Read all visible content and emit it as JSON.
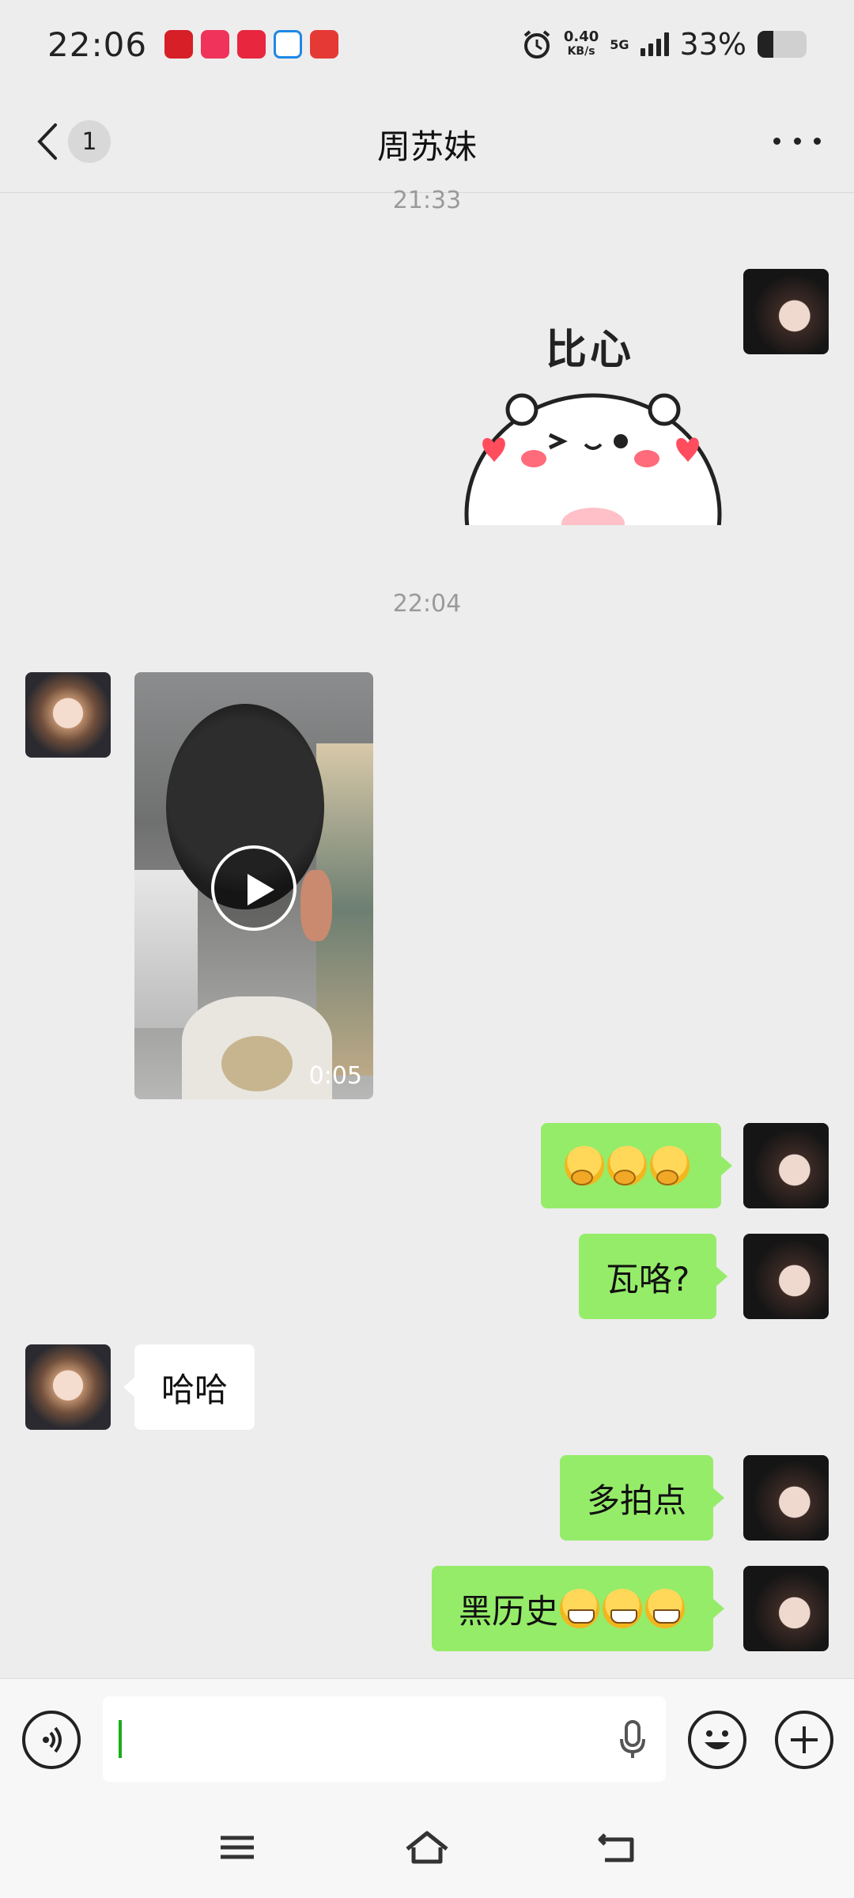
{
  "status_bar": {
    "time": "22:06",
    "speed_value": "0.40",
    "speed_unit": "KB/s",
    "network": "5G",
    "battery_percent": "33%",
    "battery_level": 0.33
  },
  "header": {
    "unread_count": "1",
    "title": "周苏妹"
  },
  "messages": {
    "timestamp_1": "21:33",
    "sticker_text": "比心",
    "timestamp_2": "22:04",
    "video_duration": "0:05",
    "msg_wa_ge": "瓦咯?",
    "msg_haha": "哈哈",
    "msg_duo_pai_dian": "多拍点",
    "msg_hei_li_shi": "黑历史"
  },
  "colors": {
    "my_bubble": "#95ec69",
    "other_bubble": "#ffffff",
    "background": "#ededed"
  },
  "icons": [
    "back-icon",
    "more-icon",
    "play-icon",
    "voice-icon",
    "microphone-icon",
    "emoji-icon",
    "plus-icon",
    "menu-icon",
    "home-icon",
    "back-nav-icon"
  ]
}
